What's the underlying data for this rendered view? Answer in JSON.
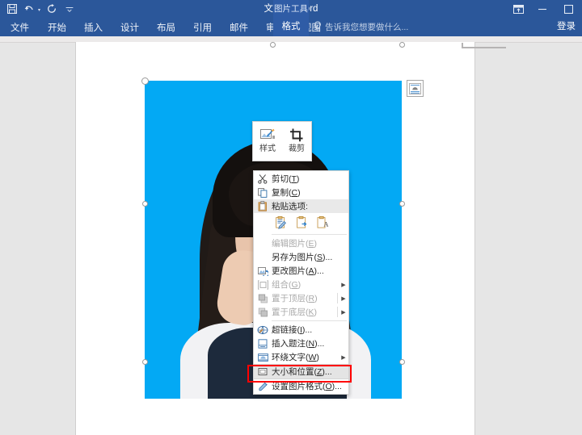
{
  "titlebar": {
    "document_title": "文档1 - Word",
    "quick_access": [
      {
        "name": "save",
        "icon": "save-icon"
      },
      {
        "name": "undo",
        "icon": "undo-icon"
      },
      {
        "name": "redo",
        "icon": "redo-icon"
      },
      {
        "name": "customize",
        "icon": "customize-qat-icon"
      }
    ],
    "window_controls": [
      {
        "name": "ribbon-display-options",
        "icon": "ribbon-display-icon"
      },
      {
        "name": "minimize",
        "icon": "minimize-icon",
        "glyph": "—"
      },
      {
        "name": "maximize",
        "icon": "maximize-icon",
        "glyph": "□"
      }
    ]
  },
  "ribbon": {
    "tabs": [
      {
        "label": "文件",
        "active": false
      },
      {
        "label": "开始",
        "active": false
      },
      {
        "label": "插入",
        "active": false
      },
      {
        "label": "设计",
        "active": false
      },
      {
        "label": "布局",
        "active": false
      },
      {
        "label": "引用",
        "active": false
      },
      {
        "label": "邮件",
        "active": false
      },
      {
        "label": "审阅",
        "active": false
      },
      {
        "label": "视图",
        "active": false
      }
    ],
    "contextual": {
      "group_title": "图片工具",
      "tab_label": "格式",
      "active": true
    },
    "tell_me": {
      "icon": "lightbulb-icon",
      "placeholder": "告诉我您想要做什么..."
    },
    "sign_in": "登录"
  },
  "canvas": {
    "picture": {
      "name": "selected-picture",
      "background_color": "#03a9f4",
      "selected": true,
      "handles": [
        "top-left",
        "top-center",
        "top-right",
        "middle-left",
        "middle-right",
        "bottom-left",
        "bottom-center",
        "bottom-right"
      ],
      "rotation_handle": "rotate-handle"
    },
    "layout_options_button": {
      "name": "layout-options-button",
      "icon": "layout-options-icon"
    }
  },
  "mini_toolbar": {
    "items": [
      {
        "label": "样式",
        "icon": "picture-style-icon"
      },
      {
        "label": "裁剪",
        "icon": "crop-icon"
      }
    ]
  },
  "context_menu": {
    "items": [
      {
        "id": "cut",
        "label": "剪切(",
        "accel": "T",
        "suffix": ")",
        "icon": "scissors-icon",
        "disabled": false,
        "submenu": false,
        "state": "normal"
      },
      {
        "id": "copy",
        "label": "复制(",
        "accel": "C",
        "suffix": ")",
        "icon": "copy-icon",
        "disabled": false,
        "submenu": false,
        "state": "normal"
      },
      {
        "id": "paste-options",
        "label": "粘贴选项:",
        "accel": "",
        "suffix": "",
        "icon": "paste-icon",
        "disabled": false,
        "submenu": false,
        "state": "highlight"
      },
      {
        "id": "paste-gallery",
        "type": "icon-row",
        "icons": [
          "keep-source-formatting-icon",
          "picture-icon",
          "keep-text-only-icon"
        ]
      },
      {
        "id": "separator-1",
        "type": "separator"
      },
      {
        "id": "edit-picture",
        "label": "编辑图片(",
        "accel": "E",
        "suffix": ")",
        "icon": "",
        "disabled": true,
        "submenu": false,
        "state": "disabled"
      },
      {
        "id": "save-as-picture",
        "label": "另存为图片(",
        "accel": "S",
        "suffix": ")...",
        "icon": "",
        "disabled": false,
        "submenu": false,
        "state": "normal"
      },
      {
        "id": "change-picture",
        "label": "更改图片(",
        "accel": "A",
        "suffix": ")...",
        "icon": "change-picture-icon",
        "disabled": false,
        "submenu": false,
        "state": "normal"
      },
      {
        "id": "group",
        "label": "组合(",
        "accel": "G",
        "suffix": ")",
        "icon": "group-icon",
        "disabled": true,
        "submenu": true,
        "state": "disabled"
      },
      {
        "id": "bring-to-front",
        "label": "置于顶层(",
        "accel": "R",
        "suffix": ")",
        "icon": "bring-front-icon",
        "disabled": true,
        "submenu": true,
        "state": "disabled"
      },
      {
        "id": "send-to-back",
        "label": "置于底层(",
        "accel": "K",
        "suffix": ")",
        "icon": "send-back-icon",
        "disabled": true,
        "submenu": true,
        "state": "disabled"
      },
      {
        "id": "separator-2",
        "type": "separator"
      },
      {
        "id": "hyperlink",
        "label": "超链接(",
        "accel": "I",
        "suffix": ")...",
        "icon": "hyperlink-icon",
        "disabled": false,
        "submenu": false,
        "state": "normal"
      },
      {
        "id": "insert-caption",
        "label": "插入题注(",
        "accel": "N",
        "suffix": ")...",
        "icon": "caption-icon",
        "disabled": false,
        "submenu": false,
        "state": "normal"
      },
      {
        "id": "wrap-text",
        "label": "环绕文字(",
        "accel": "W",
        "suffix": ")",
        "icon": "wrap-text-icon",
        "disabled": false,
        "submenu": true,
        "state": "normal"
      },
      {
        "id": "size-and-position",
        "label": "大小和位置(",
        "accel": "Z",
        "suffix": ")...",
        "icon": "size-position-icon",
        "disabled": false,
        "submenu": false,
        "state": "selected"
      },
      {
        "id": "format-picture",
        "label": "设置图片格式(",
        "accel": "O",
        "suffix": ")...",
        "icon": "format-picture-icon",
        "disabled": false,
        "submenu": false,
        "state": "normal"
      }
    ],
    "highlight_box_color": "#ff0000",
    "highlighted_item_id": "size-and-position"
  }
}
